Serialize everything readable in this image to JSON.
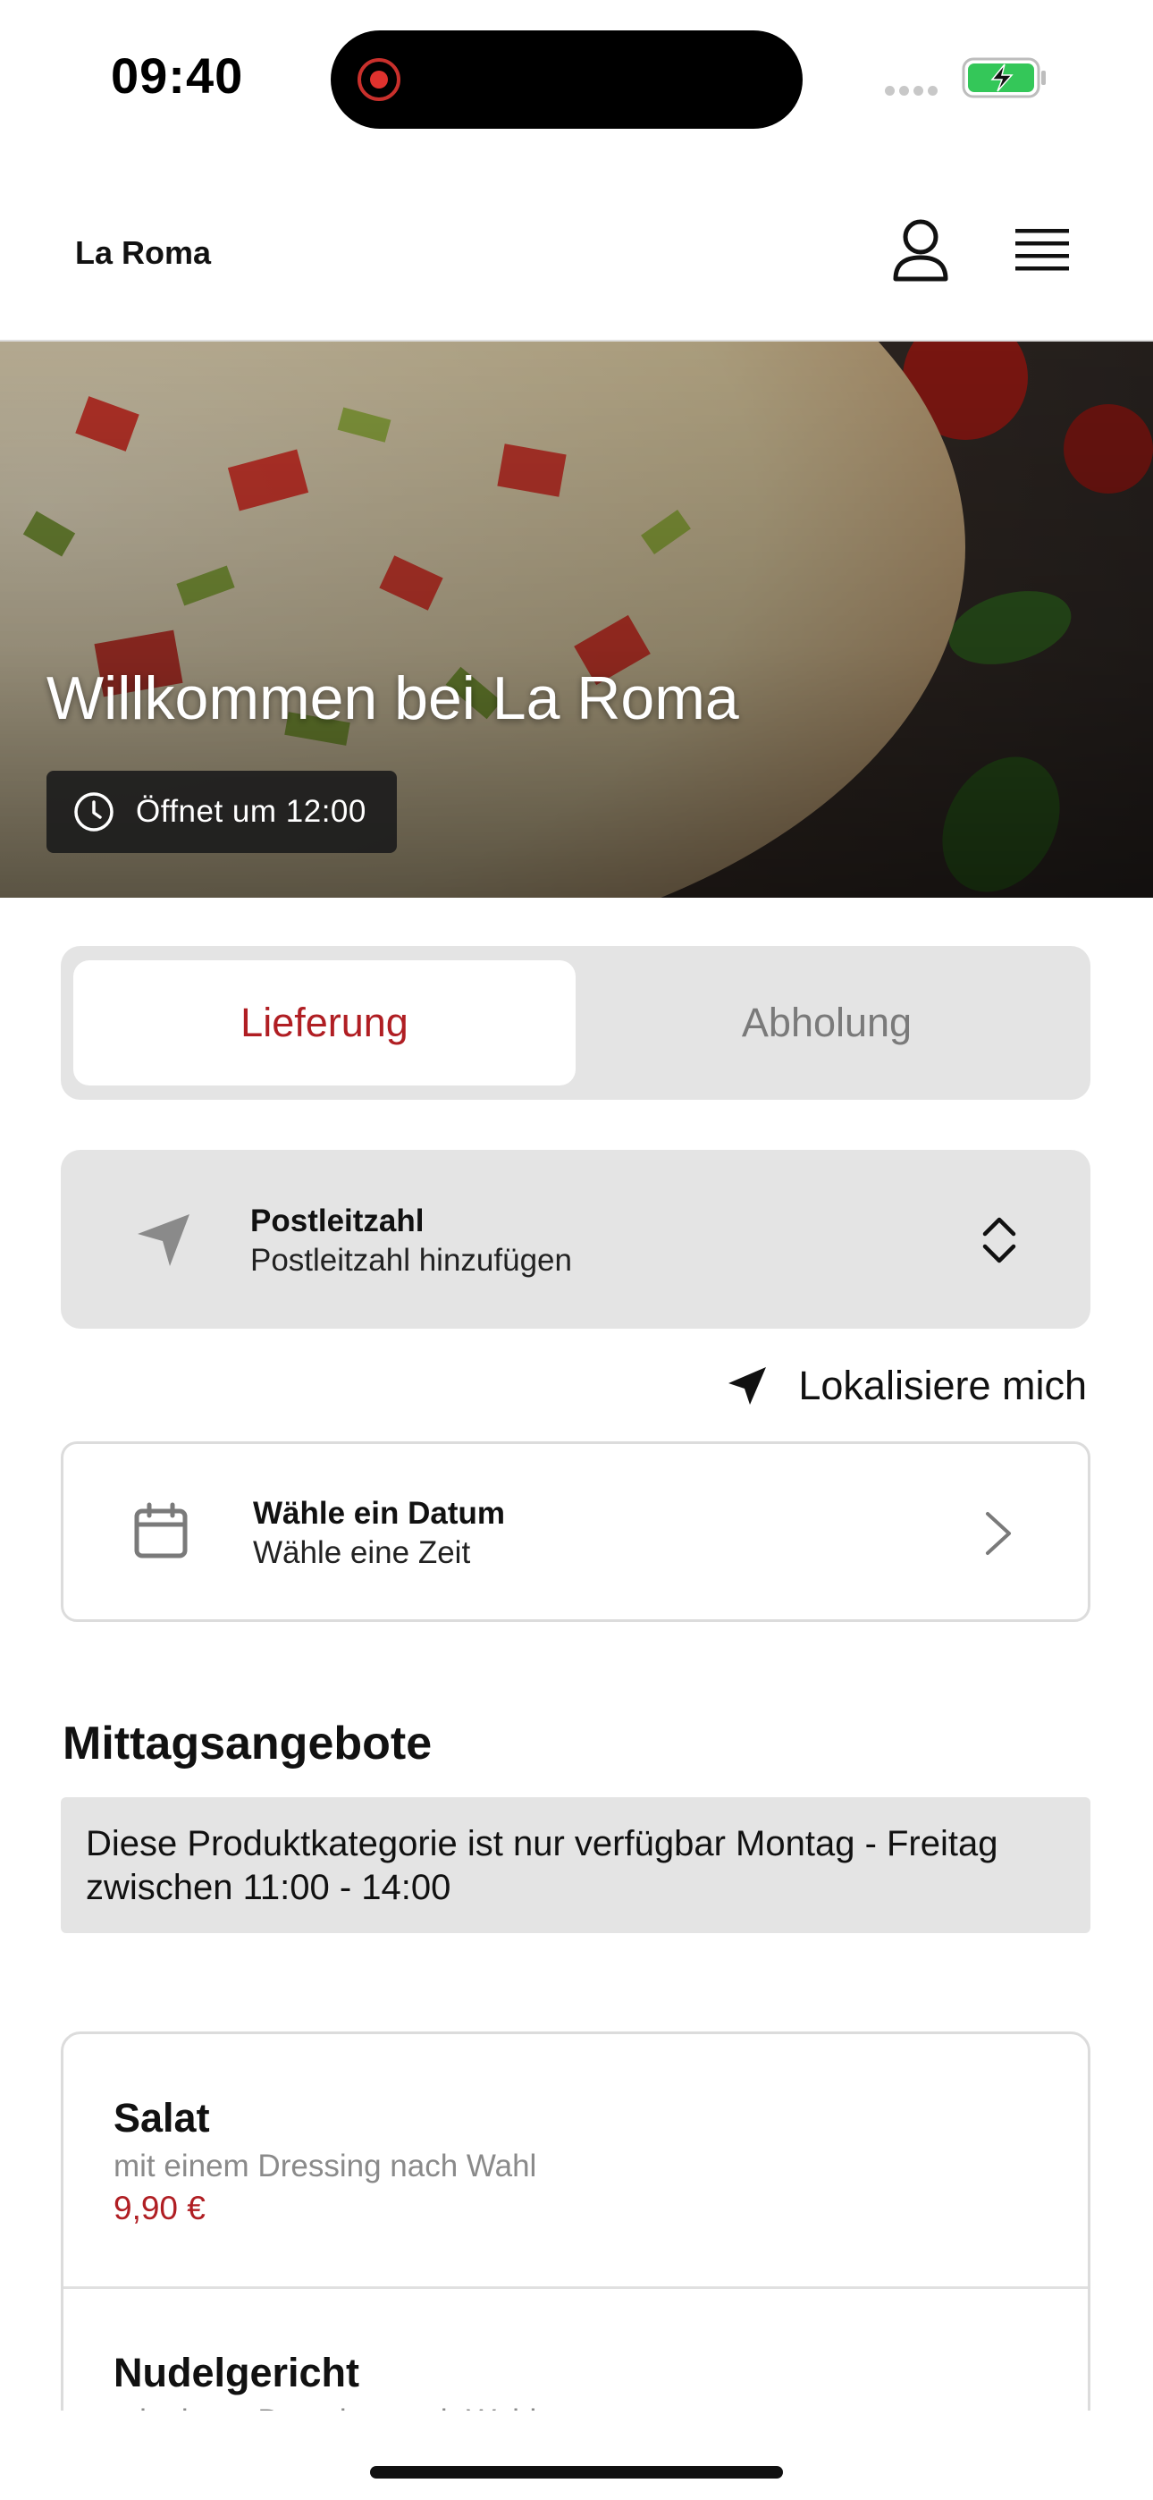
{
  "status_bar": {
    "time": "09:40"
  },
  "header": {
    "brand": "La Roma",
    "icons": {
      "profile": "person-icon",
      "menu": "hamburger-menu-icon"
    }
  },
  "hero": {
    "title": "Willkommen bei La Roma",
    "opening_badge": "Öffnet um 12:00"
  },
  "order_mode": {
    "tabs": [
      {
        "label": "Lieferung",
        "selected": true
      },
      {
        "label": "Abholung",
        "selected": false
      }
    ]
  },
  "postal_code": {
    "title": "Postleitzahl",
    "placeholder": "Postleitzahl hinzufügen"
  },
  "locate": {
    "label": "Lokalisiere mich"
  },
  "schedule": {
    "title": "Wähle ein Datum",
    "subtitle": "Wähle eine Zeit"
  },
  "lunch_section": {
    "title": "Mittagsangebote",
    "notice": "Diese Produktkategorie ist nur verfügbar Montag - Freitag zwischen 11:00 - 14:00",
    "items": [
      {
        "name": "Salat",
        "description": "mit einem Dressing nach Wahl",
        "price": "9,90 €"
      },
      {
        "name": "Nudelgericht",
        "description": "mit einem Dressing nach Wahl"
      }
    ]
  },
  "colors": {
    "accent": "#b01e23",
    "panel_grey": "#e4e4e4",
    "badge_bg": "#1c1c1c",
    "battery_green": "#34c759"
  }
}
